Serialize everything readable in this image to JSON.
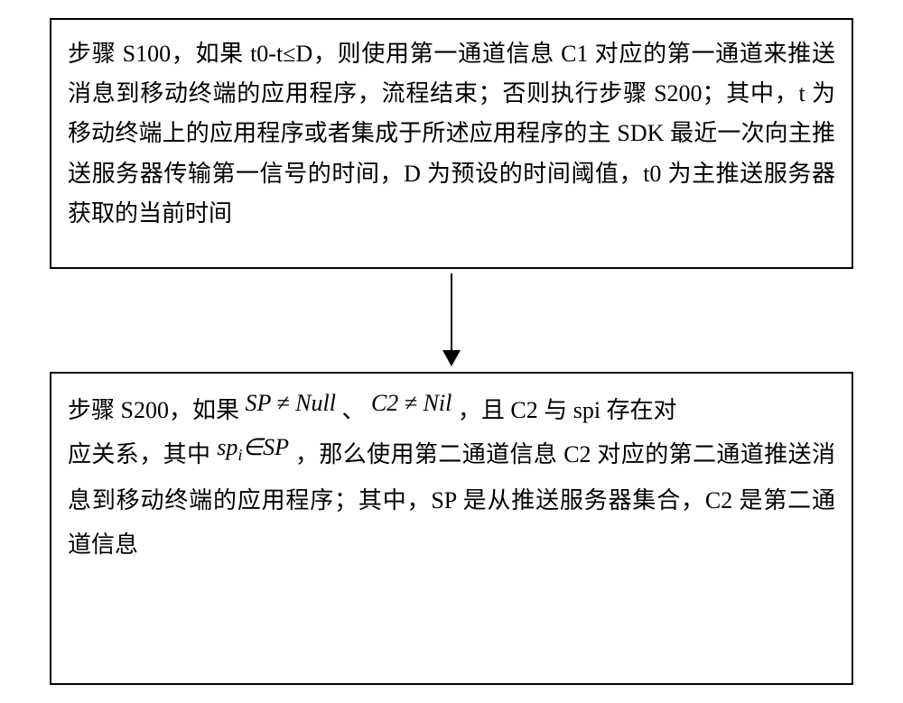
{
  "flow": {
    "box1": {
      "text": "步骤 S100，如果 t0-t≤D，则使用第一通道信息 C1 对应的第一通道来推送消息到移动终端的应用程序，流程结束；否则执行步骤 S200；其中，t 为移动终端上的应用程序或者集成于所述应用程序的主 SDK 最近一次向主推送服务器传输第一信号的时间，D 为预设的时间阈值，t0 为主推送服务器获取的当前时间"
    },
    "box2": {
      "seg1": "步骤 S200，如果",
      "math1": "SP ≠ Null",
      "seg2": "、",
      "math2": "C2 ≠ Nil",
      "seg3": " ，且 C2 与 spi 存在对",
      "seg4": "应关系，其中",
      "math3_a": "sp",
      "math3_sub": "i",
      "math3_b": "∈SP",
      "seg5": " ，那么使用第二通道信息 C2 对应的第二通道推送消息到移动终端的应用程序；其中，SP 是从推送服务器集合，C2 是第二通道信息"
    }
  }
}
